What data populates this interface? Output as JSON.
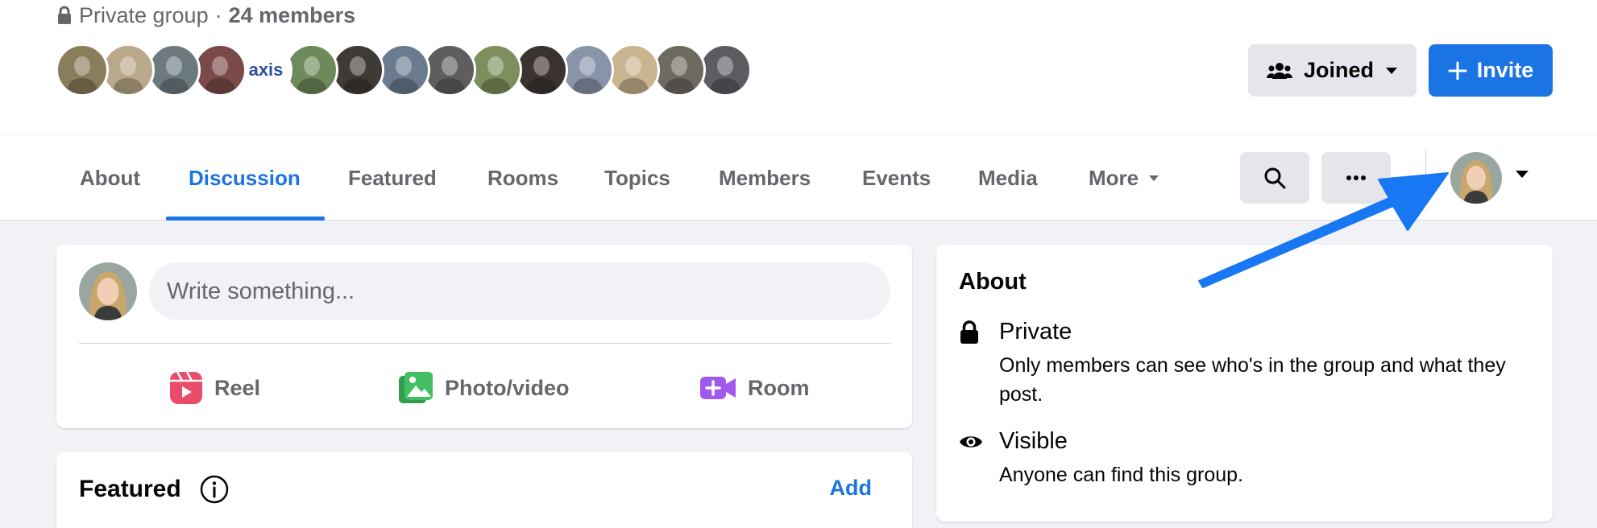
{
  "group": {
    "privacy_label": "Private group",
    "separator": "·",
    "member_count": "24 members",
    "member_avatars": [
      {
        "name": "member-avatar-1",
        "color": "#8a7d5c"
      },
      {
        "name": "member-avatar-2",
        "color": "#b9a88a"
      },
      {
        "name": "member-avatar-3",
        "color": "#6c7a80"
      },
      {
        "name": "member-avatar-4",
        "color": "#7a4a48"
      },
      {
        "name": "member-avatar-5",
        "color": "#ffffff",
        "text": "axis"
      },
      {
        "name": "member-avatar-6",
        "color": "#6d8a5a"
      },
      {
        "name": "member-avatar-7",
        "color": "#3e3a36"
      },
      {
        "name": "member-avatar-8",
        "color": "#6a7b8f"
      },
      {
        "name": "member-avatar-9",
        "color": "#5e5e5e"
      },
      {
        "name": "member-avatar-10",
        "color": "#7d8f5c"
      },
      {
        "name": "member-avatar-11",
        "color": "#3b3330"
      },
      {
        "name": "member-avatar-12",
        "color": "#8a94a8"
      },
      {
        "name": "member-avatar-13",
        "color": "#c9b58f"
      },
      {
        "name": "member-avatar-14",
        "color": "#6f6a60"
      },
      {
        "name": "member-avatar-15",
        "color": "#5b5d60"
      }
    ],
    "joined_label": "Joined",
    "invite_label": "Invite"
  },
  "nav": {
    "tabs": [
      {
        "label": "About"
      },
      {
        "label": "Discussion",
        "active": true
      },
      {
        "label": "Featured"
      },
      {
        "label": "Rooms"
      },
      {
        "label": "Topics"
      },
      {
        "label": "Members"
      },
      {
        "label": "Events"
      },
      {
        "label": "Media"
      },
      {
        "label": "More"
      }
    ]
  },
  "composer": {
    "placeholder": "Write something...",
    "actions": [
      {
        "label": "Reel",
        "icon": "reel-icon",
        "color": "#e94b6a"
      },
      {
        "label": "Photo/video",
        "icon": "photo-video-icon",
        "color": "#45bd62"
      },
      {
        "label": "Room",
        "icon": "room-video-icon",
        "color": "#a158ec"
      }
    ]
  },
  "featured": {
    "title": "Featured",
    "add_label": "Add"
  },
  "about": {
    "title": "About",
    "rows": [
      {
        "icon": "lock-icon",
        "title": "Private",
        "description": "Only members can see who's in the group and what they post."
      },
      {
        "icon": "eye-icon",
        "title": "Visible",
        "description": "Anyone can find this group."
      }
    ]
  },
  "colors": {
    "accent": "#1b74e4",
    "annotation_arrow": "#1877f2",
    "page_background": "#f0f2f5"
  }
}
